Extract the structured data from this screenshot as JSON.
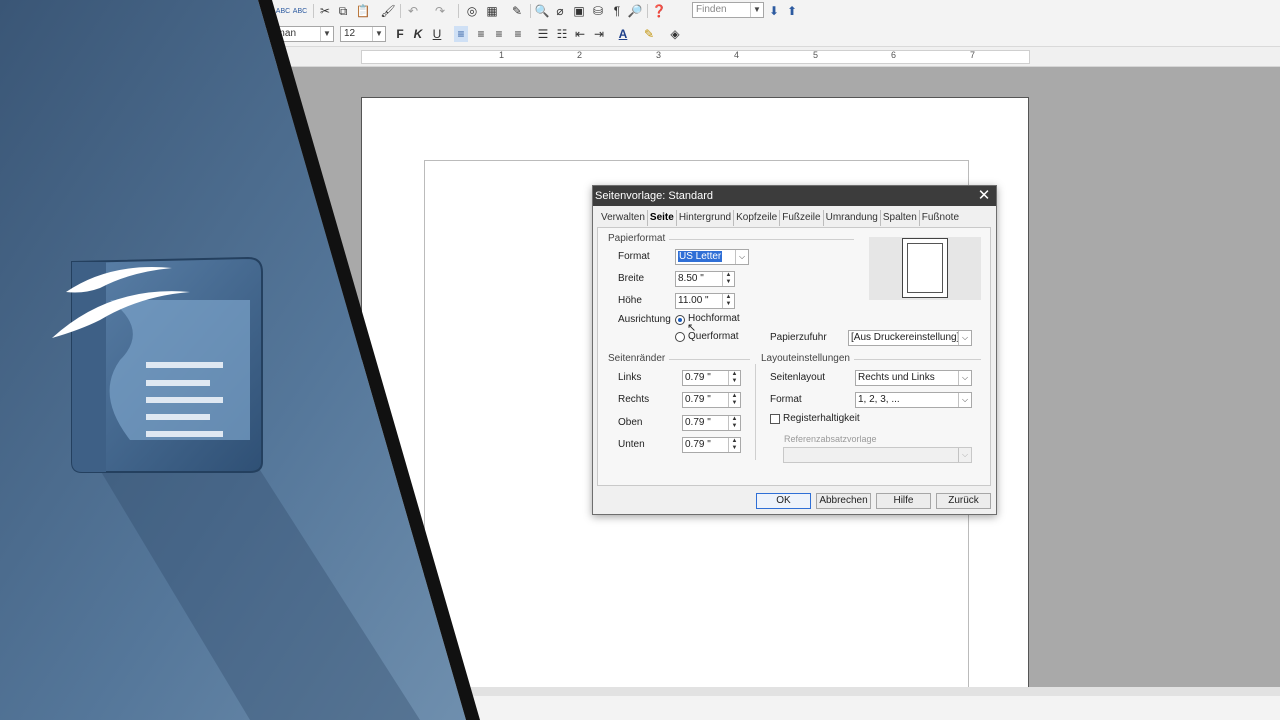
{
  "toolbar": {
    "find_placeholder": "Finden",
    "font_name": "oman",
    "font_size": "12",
    "bold": "F",
    "italic": "K",
    "underline": "U"
  },
  "ruler": {
    "numbers": [
      "1",
      "2",
      "3",
      "4",
      "5",
      "6",
      "7"
    ]
  },
  "dialog": {
    "title": "Seitenvorlage: Standard",
    "close": "✕",
    "tabs": [
      "Verwalten",
      "Seite",
      "Hintergrund",
      "Kopfzeile",
      "Fußzeile",
      "Umrandung",
      "Spalten",
      "Fußnote"
    ],
    "active_tab": "Seite",
    "paper": {
      "section": "Papierformat",
      "format_label": "Format",
      "format_value": "US Letter",
      "width_label": "Breite",
      "width_value": "8.50 \"",
      "height_label": "Höhe",
      "height_value": "11.00 \"",
      "orientation_label": "Ausrichtung",
      "portrait": "Hochformat",
      "landscape": "Querformat",
      "orientation_selected": "Hochformat",
      "tray_label": "Papierzufuhr",
      "tray_value": "[Aus Druckereinstellung]"
    },
    "margins": {
      "section": "Seitenränder",
      "left_label": "Links",
      "left_value": "0.79 \"",
      "right_label": "Rechts",
      "right_value": "0.79 \"",
      "top_label": "Oben",
      "top_value": "0.79 \"",
      "bottom_label": "Unten",
      "bottom_value": "0.79 \""
    },
    "layout": {
      "section": "Layouteinstellungen",
      "page_layout_label": "Seitenlayout",
      "page_layout_value": "Rechts und Links",
      "format_label": "Format",
      "format_value": "1, 2, 3, ...",
      "register_label": "Registerhaltigkeit",
      "register_checked": false,
      "ref_style_label": "Referenzabsatzvorlage",
      "ref_style_value": ""
    },
    "buttons": {
      "ok": "OK",
      "cancel": "Abbrechen",
      "help": "Hilfe",
      "reset": "Zurück"
    }
  },
  "colors": {
    "overlay_dark": "#3e5a7a",
    "overlay_light": "#6a8aa8",
    "titlebar": "#3c3c3c",
    "selection": "#2f6fd6"
  },
  "icons": [
    "spellcheck-icon",
    "cut-icon",
    "copy-icon",
    "paste-icon",
    "undo-icon",
    "redo-icon",
    "table-icon",
    "find-replace-icon",
    "help-icon",
    "openoffice-logo"
  ]
}
